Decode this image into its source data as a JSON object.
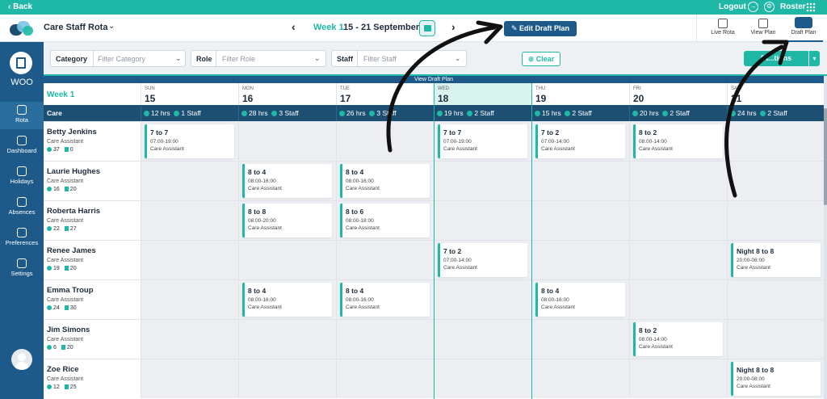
{
  "topbar": {
    "back_label": "Back",
    "logout_label": "Logout",
    "roster_label": "Roster"
  },
  "header": {
    "rota_name": "Care Staff Rota",
    "week_label": "Week 1",
    "week_range": "15 - 21 September",
    "edit_draft_label": "Edit Draft Plan",
    "view_tabs": [
      {
        "label": "Live Rota",
        "icon": "live-rota-icon"
      },
      {
        "label": "View Plan",
        "icon": "view-plan-icon"
      },
      {
        "label": "Draft Plan",
        "icon": "pencil-icon",
        "active": true
      }
    ]
  },
  "sidebar": {
    "org_name": "WOO",
    "items": [
      {
        "label": "Rota",
        "icon": "calendar-icon",
        "active": true
      },
      {
        "label": "Dashboard",
        "icon": "dashboard-icon"
      },
      {
        "label": "Holidays",
        "icon": "holidays-icon"
      },
      {
        "label": "Absences",
        "icon": "absences-icon"
      },
      {
        "label": "Preferences",
        "icon": "preferences-icon"
      },
      {
        "label": "Settings",
        "icon": "gear-icon"
      }
    ]
  },
  "filters": {
    "category": {
      "label": "Category",
      "placeholder": "Filter Category"
    },
    "role": {
      "label": "Role",
      "placeholder": "Filter Role"
    },
    "staff": {
      "label": "Staff",
      "placeholder": "Filter Staff"
    },
    "clear_label": "Clear",
    "options_label": "Di...tions"
  },
  "banner": "View Draft Plan",
  "grid": {
    "week_label": "Week 1",
    "days": [
      {
        "dow": "SUN",
        "num": "15"
      },
      {
        "dow": "MON",
        "num": "16"
      },
      {
        "dow": "TUE",
        "num": "17"
      },
      {
        "dow": "WED",
        "num": "18",
        "today": true
      },
      {
        "dow": "THU",
        "num": "19"
      },
      {
        "dow": "FRI",
        "num": "20"
      },
      {
        "dow": "SAT",
        "num": "21"
      }
    ],
    "group": {
      "name": "Care",
      "summaries": [
        {
          "hrs": "12 hrs",
          "staff": "1 Staff"
        },
        {
          "hrs": "28 hrs",
          "staff": "3 Staff"
        },
        {
          "hrs": "26 hrs",
          "staff": "3 Staff"
        },
        {
          "hrs": "19 hrs",
          "staff": "2 Staff"
        },
        {
          "hrs": "15 hrs",
          "staff": "2 Staff"
        },
        {
          "hrs": "20 hrs",
          "staff": "2 Staff"
        },
        {
          "hrs": "24 hrs",
          "staff": "2 Staff"
        }
      ]
    },
    "staff": [
      {
        "name": "Betty Jenkins",
        "role": "Care Assistant",
        "hours": "37",
        "shifts_count": "0",
        "shifts": [
          {
            "day": 0,
            "name": "7 to 7",
            "time": "07:00-19:00",
            "role": "Care Assistant"
          },
          {
            "day": 3,
            "name": "7 to 7",
            "time": "07:00-19:00",
            "role": "Care Assistant"
          },
          {
            "day": 4,
            "name": "7 to 2",
            "time": "07:00-14:00",
            "role": "Care Assistant"
          },
          {
            "day": 5,
            "name": "8 to 2",
            "time": "08:00-14:00",
            "role": "Care Assistant"
          }
        ]
      },
      {
        "name": "Laurie Hughes",
        "role": "Care Assistant",
        "hours": "16",
        "shifts_count": "20",
        "shifts": [
          {
            "day": 1,
            "name": "8 to 4",
            "time": "08:00-16:00",
            "role": "Care Assistant"
          },
          {
            "day": 2,
            "name": "8 to 4",
            "time": "08:00-16:00",
            "role": "Care Assistant"
          }
        ]
      },
      {
        "name": "Roberta Harris",
        "role": "Care Assistant",
        "hours": "22",
        "shifts_count": "27",
        "shifts": [
          {
            "day": 1,
            "name": "8 to 8",
            "time": "08:00-20:00",
            "role": "Care Assistant"
          },
          {
            "day": 2,
            "name": "8 to 6",
            "time": "08:00-18:00",
            "role": "Care Assistant"
          }
        ]
      },
      {
        "name": "Renee James",
        "role": "Care Assistant",
        "hours": "19",
        "shifts_count": "20",
        "shifts": [
          {
            "day": 3,
            "name": "7 to 2",
            "time": "07:00-14:00",
            "role": "Care Assistant"
          },
          {
            "day": 6,
            "name": "Night 8 to 8",
            "time": "20:00-08:00",
            "role": "Care Assistant"
          }
        ]
      },
      {
        "name": "Emma Troup",
        "role": "Care Assistant",
        "hours": "24",
        "shifts_count": "30",
        "shifts": [
          {
            "day": 1,
            "name": "8 to 4",
            "time": "08:00-16:00",
            "role": "Care Assistant"
          },
          {
            "day": 2,
            "name": "8 to 4",
            "time": "08:00-16:00",
            "role": "Care Assistant"
          },
          {
            "day": 4,
            "name": "8 to 4",
            "time": "08:00-16:00",
            "role": "Care Assistant"
          }
        ]
      },
      {
        "name": "Jim Simons",
        "role": "Care Assistant",
        "hours": "6",
        "shifts_count": "20",
        "shifts": [
          {
            "day": 5,
            "name": "8 to 2",
            "time": "08:00-14:00",
            "role": "Care Assistant"
          }
        ]
      },
      {
        "name": "Zoe Rice",
        "role": "Care Assistant",
        "hours": "12",
        "shifts_count": "25",
        "shifts": [
          {
            "day": 6,
            "name": "Night 8 to 8",
            "time": "20:00-08:00",
            "role": "Care Assistant"
          }
        ]
      }
    ]
  },
  "colors": {
    "teal": "#1fb8a6",
    "navy": "#1d5a8a",
    "header_row": "#1d4f73"
  }
}
